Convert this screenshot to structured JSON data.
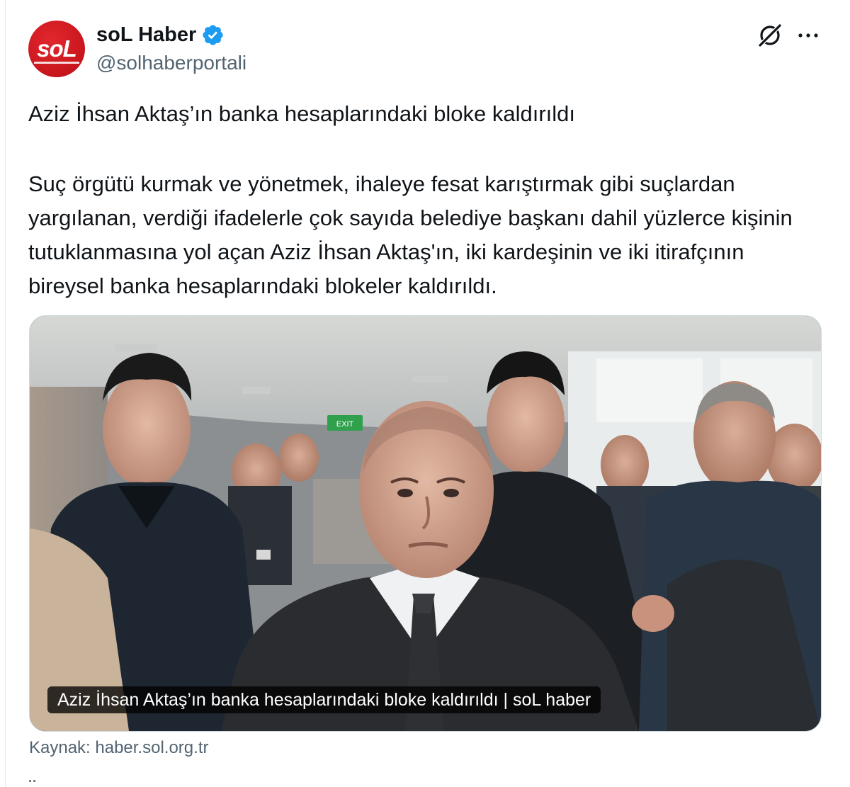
{
  "author": {
    "display_name": "soL Haber",
    "handle": "@solhaberportali",
    "avatar_text": "soL",
    "avatar_color": "#d0191f",
    "verified_color": "#1d9bf0",
    "avatar_icon": "sol-logo",
    "verified_icon": "verified-badge-icon"
  },
  "actions": {
    "grok_icon": "grok-icon",
    "more_icon": "more-options-icon"
  },
  "tweet": {
    "title": "Aziz İhsan Aktaş’ın banka hesaplarındaki bloke kaldırıldı",
    "body": "Suç örgütü kurmak ve yönetmek, ihaleye fesat karıştırmak gibi suçlardan yargılanan, verdiği ifadelerle çok sayıda belediye başkanı dahil yüzlerce kişinin tutuklanmasına yol açan Aziz İhsan Aktaş'ın, iki kardeşinin ve iki itirafçının bireysel banka hesaplarındaki blokeler kaldırıldı."
  },
  "media": {
    "caption": "Aziz İhsan Aktaş’ın banka hesaplarındaki bloke kaldırıldı | soL haber",
    "source": "Kaynak: haber.sol.org.tr",
    "sign_text": "EXIT"
  },
  "colors": {
    "text_primary": "#0f1419",
    "text_secondary": "#536471",
    "border": "#cfd9de"
  }
}
